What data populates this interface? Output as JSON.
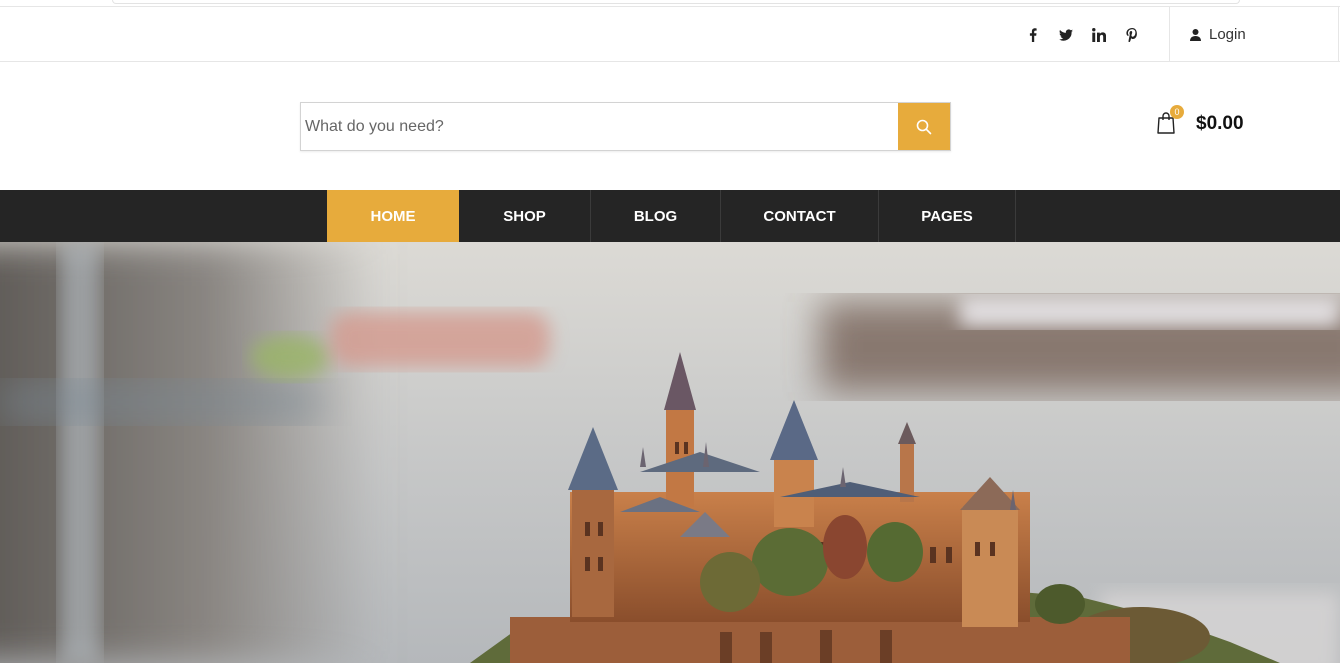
{
  "topbar": {
    "social_icons": [
      "facebook-icon",
      "twitter-icon",
      "linkedin-icon",
      "pinterest-icon"
    ],
    "login_label": "Login",
    "login_icon": "user-icon"
  },
  "search": {
    "placeholder": "What do you need?",
    "button_icon": "search-icon"
  },
  "cart": {
    "icon": "shopping-bag-icon",
    "count": "0",
    "total": "$0.00"
  },
  "nav": {
    "items": [
      {
        "label": "HOME",
        "active": true
      },
      {
        "label": "SHOP"
      },
      {
        "label": "BLOG"
      },
      {
        "label": "CONTACT"
      },
      {
        "label": "PAGES"
      }
    ]
  },
  "hero": {
    "image": "castle-on-hill-photo"
  },
  "colors": {
    "accent": "#e7ab3c",
    "nav_bg": "#252525"
  }
}
